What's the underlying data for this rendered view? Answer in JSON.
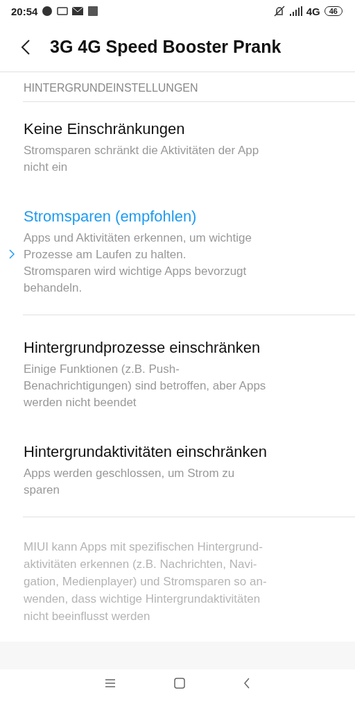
{
  "status_bar": {
    "time": "20:54",
    "network": "4G",
    "battery": "46"
  },
  "header": {
    "title": "3G 4G Speed Booster Prank"
  },
  "section": {
    "title": "HINTERGRUNDEINSTELLUNGEN"
  },
  "options": [
    {
      "title": "Keine Einschränkungen",
      "lines": [
        "Stromsparen schränkt die Aktivitäten der App",
        "nicht ein"
      ],
      "selected": false,
      "divider_after": false
    },
    {
      "title": "Stromsparen (empfohlen)",
      "lines": [
        "Apps und Aktivitäten erkennen, um wichtige",
        "Prozesse am Laufen zu halten.",
        "Stromsparen wird wichtige Apps bevorzugt",
        "behandeln."
      ],
      "selected": true,
      "divider_after": true
    },
    {
      "title": "Hintergrundprozesse einschränken",
      "lines": [
        "Einige Funktionen (z.B. Push-",
        "Benachrichtigungen) sind betroffen, aber Apps",
        "werden nicht beendet"
      ],
      "selected": false,
      "divider_after": false
    },
    {
      "title": "Hintergrundaktivitäten einschränken",
      "lines": [
        "Apps werden geschlossen, um Strom zu",
        "sparen"
      ],
      "selected": false,
      "divider_after": true
    }
  ],
  "note": {
    "lines": [
      "MIUI kann Apps mit spezifischen Hintergrund-",
      "aktivitäten erkennen (z.B. Nachrichten, Navi-",
      "gation, Medienplayer) und Stromsparen so an-",
      "wenden, dass wichtige Hintergrundaktivitäten",
      "nicht beeinflusst werden"
    ]
  }
}
